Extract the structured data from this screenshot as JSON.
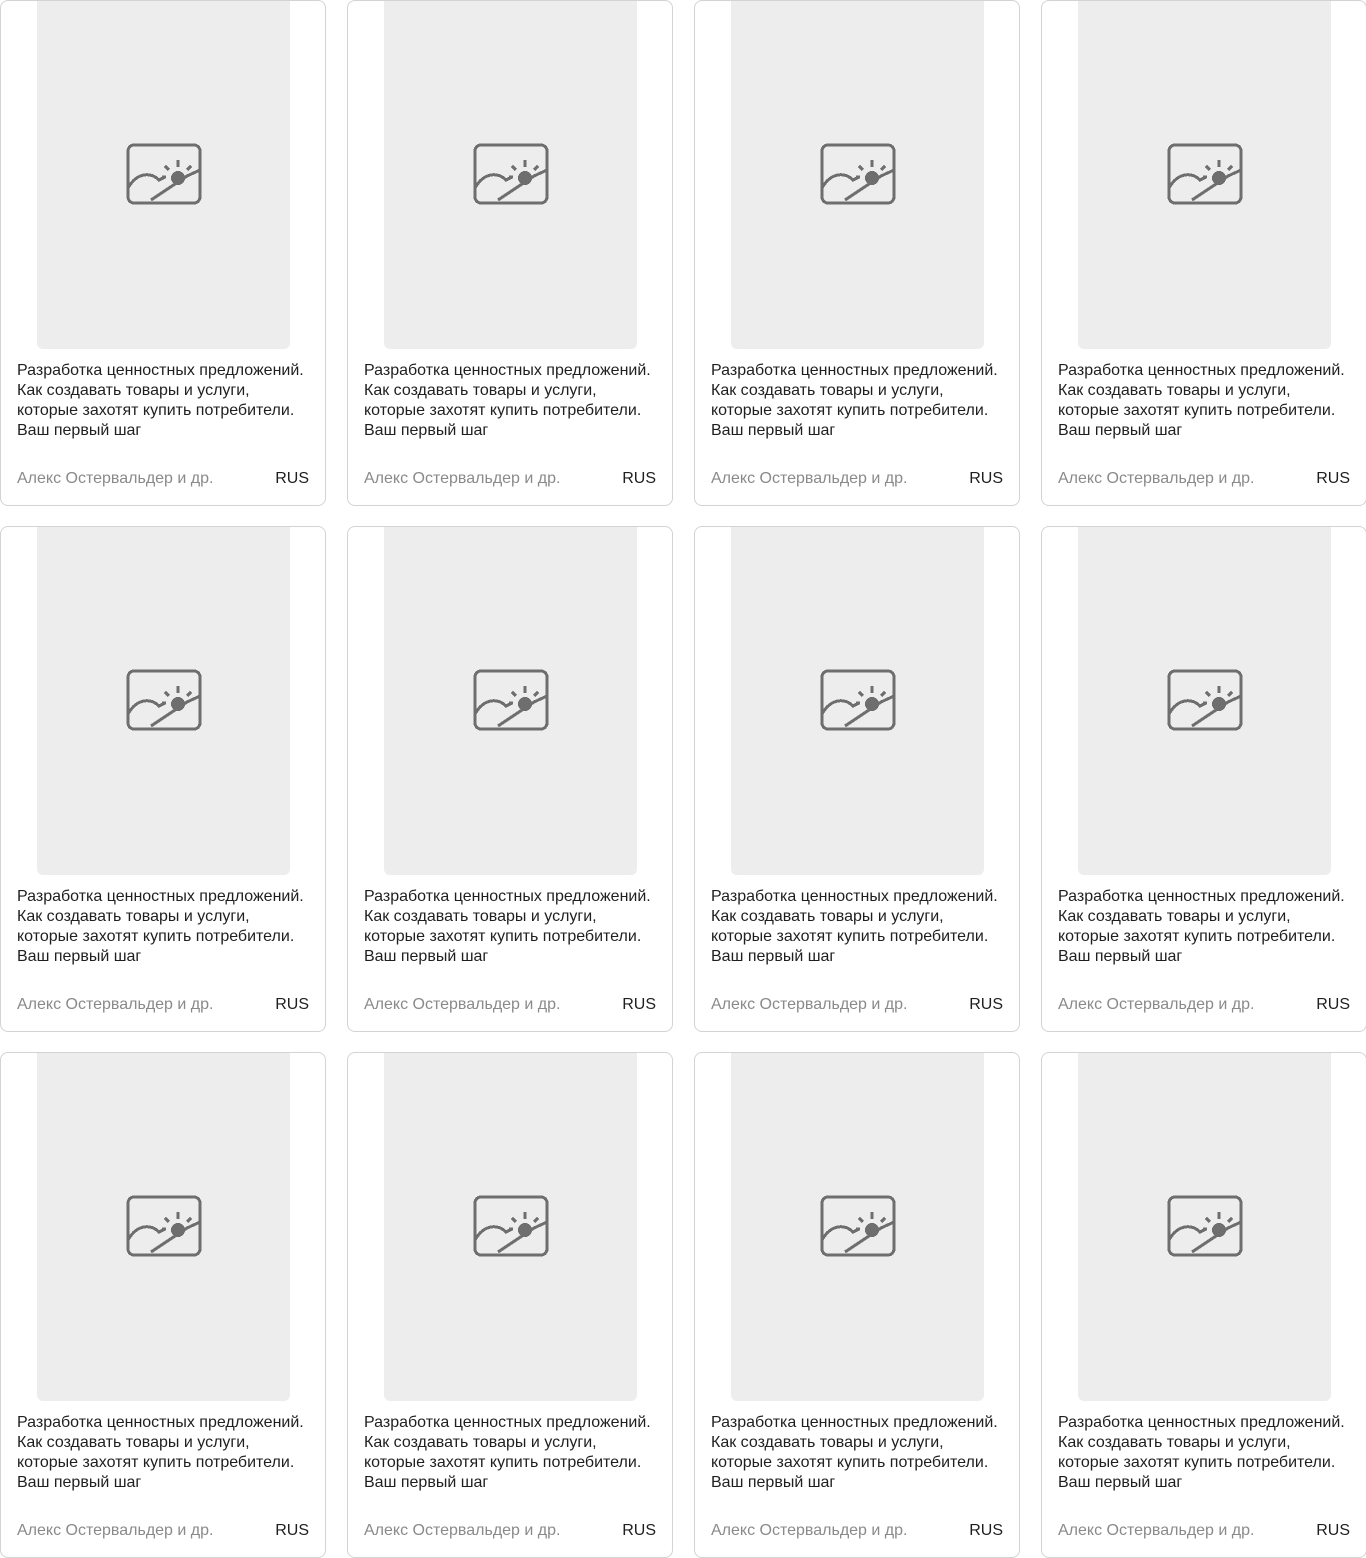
{
  "books": [
    {
      "title": "Разработка ценностных предложений. Как создавать товары и услуги, которые захотят купить потребители. Ваш первый шаг",
      "author": "Алекс Остервальдер и др.",
      "language": "RUS",
      "cover_icon": "image-placeholder-icon"
    },
    {
      "title": "Разработка ценностных предложений. Как создавать товары и услуги, которые захотят купить потребители. Ваш первый шаг",
      "author": "Алекс Остервальдер и др.",
      "language": "RUS",
      "cover_icon": "image-placeholder-icon"
    },
    {
      "title": "Разработка ценностных предложений. Как создавать товары и услуги, которые захотят купить потребители. Ваш первый шаг",
      "author": "Алекс Остервальдер и др.",
      "language": "RUS",
      "cover_icon": "image-placeholder-icon"
    },
    {
      "title": "Разработка ценностных предложений. Как создавать товары и услуги, которые захотят купить потребители. Ваш первый шаг",
      "author": "Алекс Остервальдер и др.",
      "language": "RUS",
      "cover_icon": "image-placeholder-icon"
    },
    {
      "title": "Разработка ценностных предложений. Как создавать товары и услуги, которые захотят купить потребители. Ваш первый шаг",
      "author": "Алекс Остервальдер и др.",
      "language": "RUS",
      "cover_icon": "image-placeholder-icon"
    },
    {
      "title": "Разработка ценностных предложений. Как создавать товары и услуги, которые захотят купить потребители. Ваш первый шаг",
      "author": "Алекс Остервальдер и др.",
      "language": "RUS",
      "cover_icon": "image-placeholder-icon"
    },
    {
      "title": "Разработка ценностных предложений. Как создавать товары и услуги, которые захотят купить потребители. Ваш первый шаг",
      "author": "Алекс Остервальдер и др.",
      "language": "RUS",
      "cover_icon": "image-placeholder-icon"
    },
    {
      "title": "Разработка ценностных предложений. Как создавать товары и услуги, которые захотят купить потребители. Ваш первый шаг",
      "author": "Алекс Остервальдер и др.",
      "language": "RUS",
      "cover_icon": "image-placeholder-icon"
    },
    {
      "title": "Разработка ценностных предложений. Как создавать товары и услуги, которые захотят купить потребители. Ваш первый шаг",
      "author": "Алекс Остервальдер и др.",
      "language": "RUS",
      "cover_icon": "image-placeholder-icon"
    },
    {
      "title": "Разработка ценностных предложений. Как создавать товары и услуги, которые захотят купить потребители. Ваш первый шаг",
      "author": "Алекс Остервальдер и др.",
      "language": "RUS",
      "cover_icon": "image-placeholder-icon"
    },
    {
      "title": "Разработка ценностных предложений. Как создавать товары и услуги, которые захотят купить потребители. Ваш первый шаг",
      "author": "Алекс Остервальдер и др.",
      "language": "RUS",
      "cover_icon": "image-placeholder-icon"
    },
    {
      "title": "Разработка ценностных предложений. Как создавать товары и услуги, которые захотят купить потребители. Ваш первый шаг",
      "author": "Алекс Остервальдер и др.",
      "language": "RUS",
      "cover_icon": "image-placeholder-icon"
    }
  ],
  "colors": {
    "cover_background": "#ededed",
    "icon": "#6e6e6e",
    "author_text": "#8a8a8a",
    "card_border": "#d3d3d3"
  }
}
